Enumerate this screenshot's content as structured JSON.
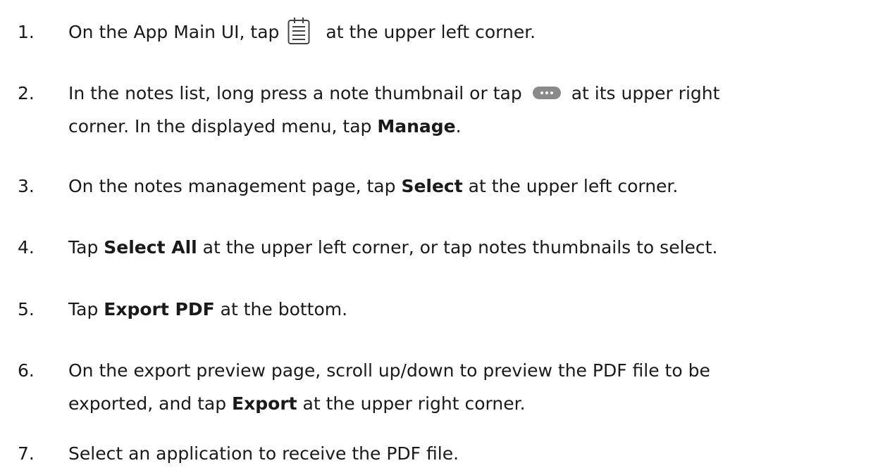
{
  "steps": [
    {
      "num": "1.",
      "parts": [
        {
          "text": "On the App Main UI, tap"
        },
        {
          "icon": "notes-list-icon"
        },
        {
          "text": "at the upper left corner."
        }
      ]
    },
    {
      "num": "2.",
      "line1": [
        {
          "text": "In the notes list, long press a note thumbnail or tap"
        },
        {
          "icon": "more-options-icon"
        },
        {
          "text": "at its upper right"
        }
      ],
      "line2": [
        {
          "text": "corner. In the displayed menu, tap "
        },
        {
          "bold": "Manage"
        },
        {
          "text": "."
        }
      ]
    },
    {
      "num": "3.",
      "parts": [
        {
          "text": "On the notes management page, tap "
        },
        {
          "bold": "Select"
        },
        {
          "text": " at the upper left corner."
        }
      ]
    },
    {
      "num": "4.",
      "parts": [
        {
          "text": "Tap "
        },
        {
          "bold": "Select All"
        },
        {
          "text": " at the upper left corner, or tap notes thumbnails to select."
        }
      ]
    },
    {
      "num": "5.",
      "parts": [
        {
          "text": "Tap "
        },
        {
          "bold": "Export PDF"
        },
        {
          "text": " at the bottom."
        }
      ]
    },
    {
      "num": "6.",
      "line1": [
        {
          "text": "On the export preview page, scroll up/down to preview the PDF file to be"
        }
      ],
      "line2": [
        {
          "text": "exported, and tap "
        },
        {
          "bold": "Export"
        },
        {
          "text": " at the upper right corner."
        }
      ]
    },
    {
      "num": "7.",
      "parts": [
        {
          "text": "Select an application to receive the PDF file."
        }
      ]
    }
  ]
}
